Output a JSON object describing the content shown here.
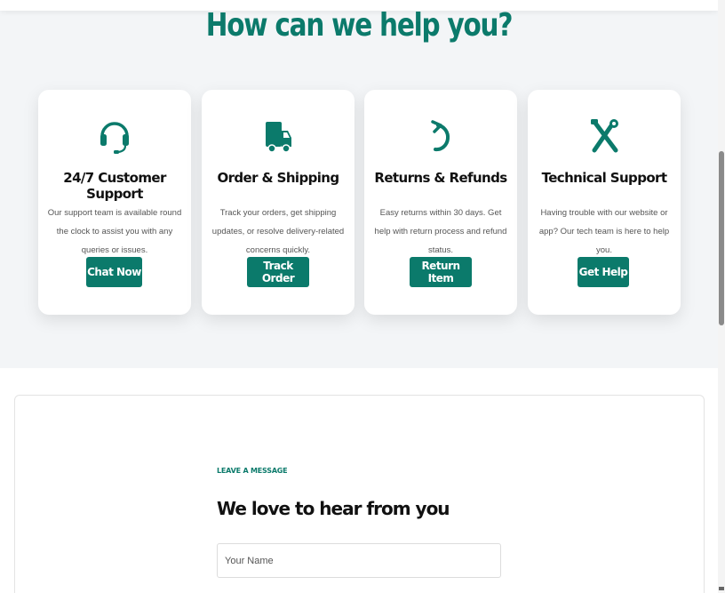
{
  "help": {
    "title": "How can we help you?",
    "cards": [
      {
        "icon": "headset-icon",
        "title": "24/7 Customer Support",
        "description": "Our support team is available round the clock to assist you with any queries or issues.",
        "button": "Chat Now"
      },
      {
        "icon": "truck-icon",
        "title": "Order & Shipping",
        "description": "Track your orders, get shipping updates, or resolve delivery-related concerns quickly.",
        "button": "Track Order"
      },
      {
        "icon": "return-arrow-icon",
        "title": "Returns & Refunds",
        "description": "Easy returns within 30 days. Get help with return process and refund status.",
        "button": "Return Item"
      },
      {
        "icon": "tools-icon",
        "title": "Technical Support",
        "description": "Having trouble with our website or app? Our tech team is here to help you.",
        "button": "Get Help"
      }
    ]
  },
  "contact": {
    "eyebrow": "LEAVE A MESSAGE",
    "title": "We love to hear from you",
    "name_placeholder": "Your Name"
  },
  "colors": {
    "accent": "#0b7a6b",
    "section_bg": "#f3f5f7"
  }
}
